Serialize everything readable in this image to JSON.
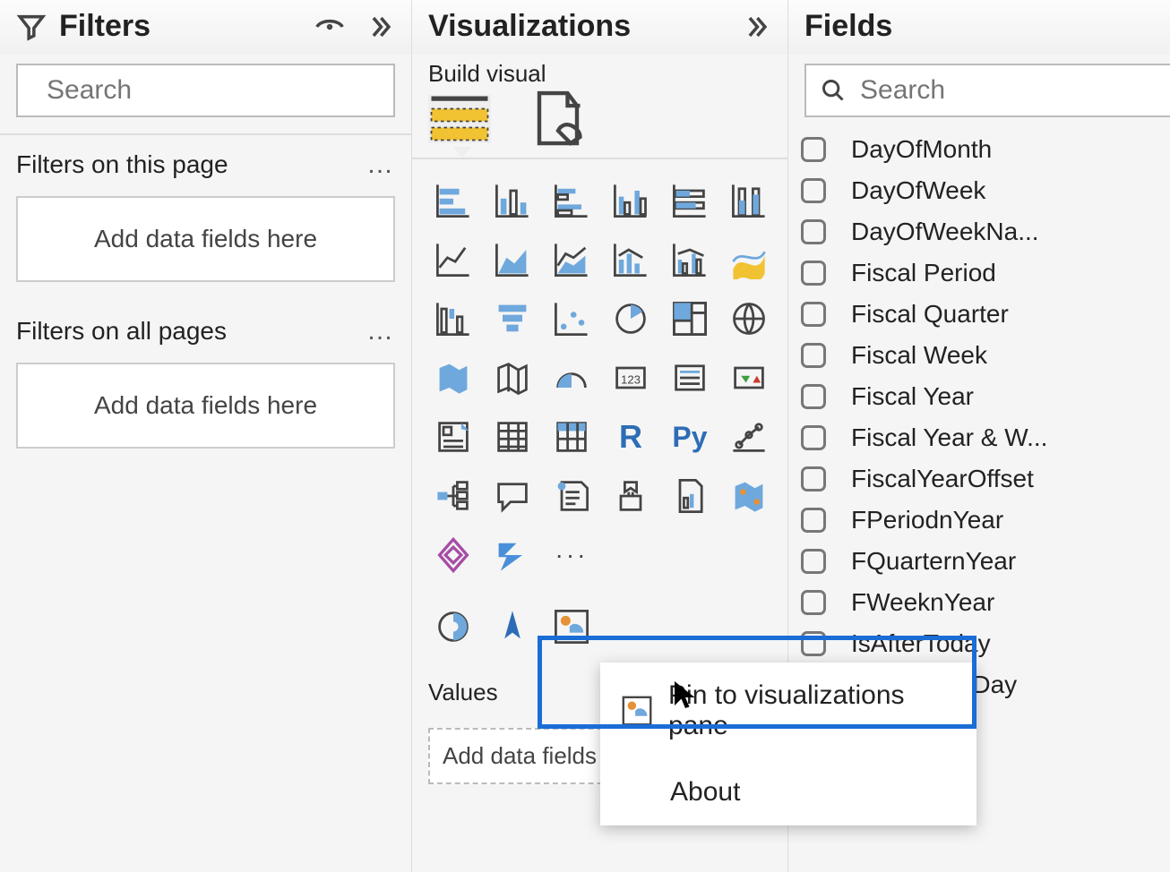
{
  "filters": {
    "title": "Filters",
    "search_placeholder": "Search",
    "section_page": "Filters on this page",
    "section_all": "Filters on all pages",
    "drop_text": "Add data fields here"
  },
  "viz": {
    "title": "Visualizations",
    "subtitle": "Build visual",
    "values_label": "Values",
    "values_drop": "Add data fields here",
    "more": "···"
  },
  "fields_pane": {
    "title": "Fields",
    "search_placeholder": "Search"
  },
  "fields": [
    "DayOfMonth",
    "DayOfWeek",
    "DayOfWeekNa...",
    "Fiscal Period",
    "Fiscal Quarter",
    "Fiscal Week",
    "Fiscal Year",
    "Fiscal Year & W...",
    "FiscalYearOffset",
    "FPeriodnYear",
    "FQuarternYear",
    "FWeeknYear",
    "IsAfterToday",
    "IsBusinessDay"
  ],
  "context_menu": {
    "pin": "Pin to visualizations pane",
    "about": "About"
  }
}
